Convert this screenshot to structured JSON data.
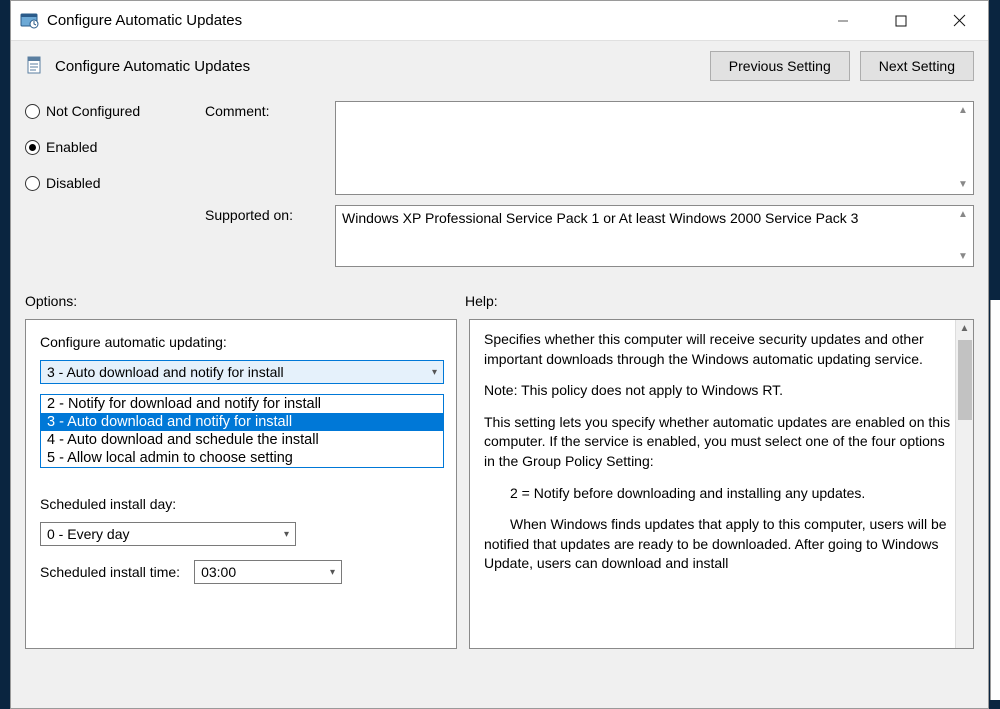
{
  "window": {
    "title": "Configure Automatic Updates"
  },
  "header": {
    "title": "Configure Automatic Updates",
    "prev": "Previous Setting",
    "next": "Next Setting"
  },
  "state": {
    "not_configured": "Not Configured",
    "enabled": "Enabled",
    "disabled": "Disabled",
    "selected": "enabled"
  },
  "fields": {
    "comment_label": "Comment:",
    "comment_value": "",
    "supported_label": "Supported on:",
    "supported_value": "Windows XP Professional Service Pack 1 or At least Windows 2000 Service Pack 3"
  },
  "sections": {
    "options": "Options:",
    "help": "Help:"
  },
  "options": {
    "configure_label": "Configure automatic updating:",
    "configure_selected": "3 - Auto download and notify for install",
    "configure_choices": [
      "2 - Notify for download and notify for install",
      "3 - Auto download and notify for install",
      "4 - Auto download and schedule the install",
      "5 - Allow local admin to choose setting"
    ],
    "highlight_index": 1,
    "sched_day_label": "Scheduled install day:",
    "sched_day_value": "0 - Every day",
    "sched_time_label": "Scheduled install time:",
    "sched_time_value": "03:00"
  },
  "help": {
    "p1": "Specifies whether this computer will receive security updates and other important downloads through the Windows automatic updating service.",
    "p2": "Note: This policy does not apply to Windows RT.",
    "p3": "This setting lets you specify whether automatic updates are enabled on this computer. If the service is enabled, you must select one of the four options in the Group Policy Setting:",
    "p4": "2 = Notify before downloading and installing any updates.",
    "p5": "When Windows finds updates that apply to this computer, users will be notified that updates are ready to be downloaded. After going to Windows Update, users can download and install"
  }
}
